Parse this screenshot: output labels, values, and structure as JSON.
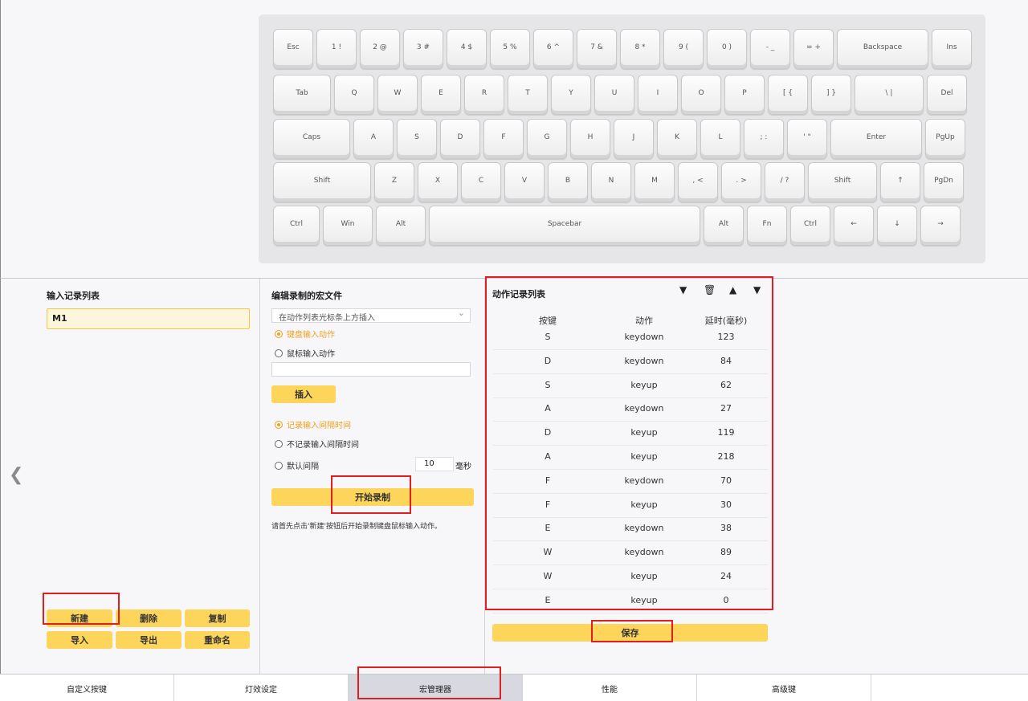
{
  "keyboard": {
    "rows": [
      [
        "Esc",
        "1 !",
        "2 @",
        "3 #",
        "4 $",
        "5 %",
        "6 ^",
        "7 &",
        "8 *",
        "9 (",
        "0 )",
        "- _",
        "= +",
        "Backspace",
        "Ins"
      ],
      [
        "Tab",
        "Q",
        "W",
        "E",
        "R",
        "T",
        "Y",
        "U",
        "I",
        "O",
        "P",
        "[ {",
        "] }",
        "\\ |",
        "Del"
      ],
      [
        "Caps",
        "A",
        "S",
        "D",
        "F",
        "G",
        "H",
        "J",
        "K",
        "L",
        "; :",
        "' \"",
        "Enter",
        "PgUp"
      ],
      [
        "Shift",
        "Z",
        "X",
        "C",
        "V",
        "B",
        "N",
        "M",
        ", <",
        ". >",
        "/ ?",
        "Shift",
        "↑",
        "PgDn"
      ],
      [
        "Ctrl",
        "Win",
        "Alt",
        "Spacebar",
        "Alt",
        "Fn",
        "Ctrl",
        "←",
        "↓",
        "→"
      ]
    ]
  },
  "records": {
    "title": "输入记录列表",
    "items": [
      "M1"
    ],
    "buttons": {
      "new": "新建",
      "delete": "删除",
      "copy": "复制",
      "import": "导入",
      "export": "导出",
      "rename": "重命名"
    }
  },
  "editor": {
    "title": "编辑录制的宏文件",
    "insert_mode": "在动作列表光标条上方插入",
    "radio_keyboard": "键盘输入动作",
    "radio_mouse": "鼠标输入动作",
    "insert_label": "插入",
    "radio_record_interval": "记录输入间隔时间",
    "radio_no_interval": "不记录输入间隔时间",
    "radio_default_interval": "默认间隔",
    "default_interval_value": "10",
    "default_interval_unit": "毫秒",
    "start_record_label": "开始录制",
    "hint": "请首先点击'新建'按钮后开始录制键盘鼠标输入动作。"
  },
  "actions": {
    "title": "动作记录列表",
    "columns": [
      "按键",
      "动作",
      "延时(毫秒)"
    ],
    "rows": [
      [
        "S",
        "keydown",
        "123"
      ],
      [
        "D",
        "keydown",
        "84"
      ],
      [
        "S",
        "keyup",
        "62"
      ],
      [
        "A",
        "keydown",
        "27"
      ],
      [
        "D",
        "keyup",
        "119"
      ],
      [
        "A",
        "keyup",
        "218"
      ],
      [
        "F",
        "keydown",
        "70"
      ],
      [
        "F",
        "keyup",
        "30"
      ],
      [
        "E",
        "keydown",
        "38"
      ],
      [
        "W",
        "keydown",
        "89"
      ],
      [
        "W",
        "keyup",
        "24"
      ],
      [
        "E",
        "keyup",
        "0"
      ]
    ],
    "save_label": "保存"
  },
  "tabs": [
    "自定义按键",
    "灯效设定",
    "宏管理器",
    "性能",
    "高级键"
  ],
  "active_tab": 2,
  "colors": {
    "accent": "#fdd55a",
    "highlight": "#e02020"
  }
}
